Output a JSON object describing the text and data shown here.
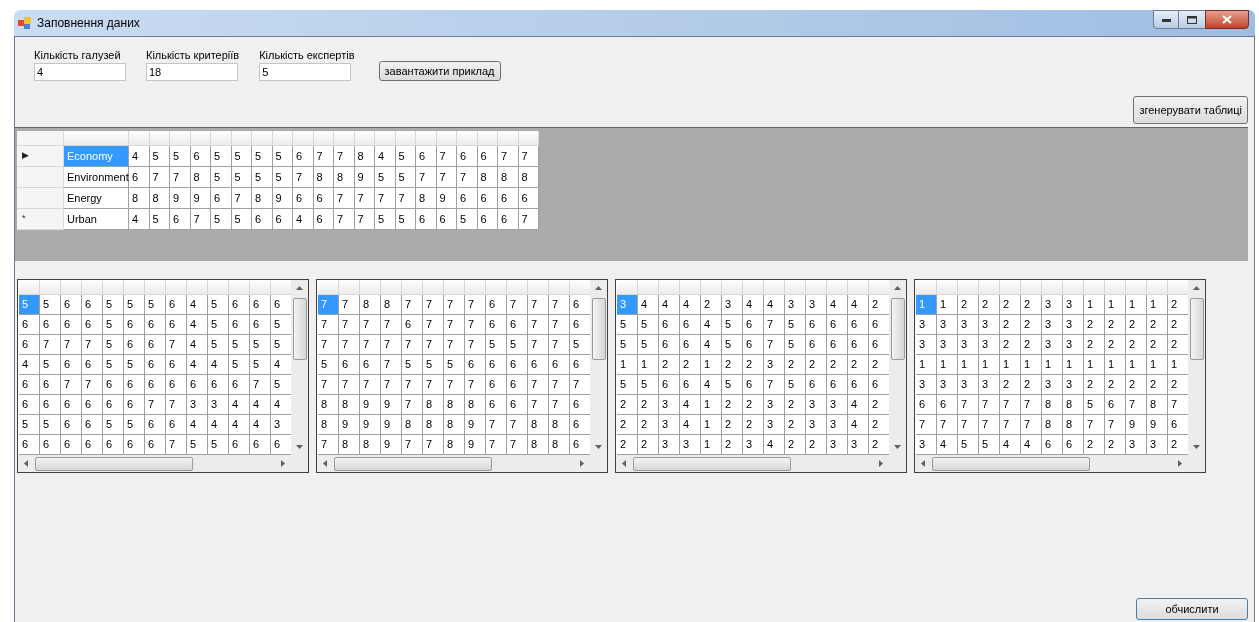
{
  "window": {
    "title": "Заповнення даних"
  },
  "fields": [
    {
      "label": "Кількість галузей",
      "value": "4"
    },
    {
      "label": "Кількість критеріїв",
      "value": "18"
    },
    {
      "label": "Кількість експертів",
      "value": "5"
    }
  ],
  "load_button": "завантажити приклад",
  "generate_button": "згенерувати таблиці",
  "top_grid": {
    "rows": [
      {
        "marker": "▶",
        "name": "Economy",
        "selected": true,
        "values": [
          "4",
          "5",
          "5",
          "6",
          "5",
          "5",
          "5",
          "5",
          "6",
          "7",
          "7",
          "8",
          "4",
          "5",
          "6",
          "7",
          "6",
          "6",
          "7",
          "7"
        ]
      },
      {
        "marker": "",
        "name": "Environment",
        "selected": false,
        "values": [
          "6",
          "7",
          "7",
          "8",
          "5",
          "5",
          "5",
          "5",
          "7",
          "8",
          "8",
          "9",
          "5",
          "5",
          "7",
          "7",
          "7",
          "8",
          "8",
          "8"
        ]
      },
      {
        "marker": "",
        "name": "Energy",
        "selected": false,
        "values": [
          "8",
          "8",
          "9",
          "9",
          "6",
          "7",
          "8",
          "9",
          "6",
          "6",
          "7",
          "7",
          "7",
          "7",
          "8",
          "9",
          "6",
          "6",
          "6",
          "6"
        ]
      },
      {
        "marker": "*",
        "name": "Urban",
        "selected": false,
        "values": [
          "4",
          "5",
          "6",
          "7",
          "5",
          "5",
          "6",
          "6",
          "4",
          "6",
          "7",
          "7",
          "5",
          "5",
          "6",
          "6",
          "5",
          "6",
          "6",
          "7"
        ]
      }
    ]
  },
  "expert_grids": [
    {
      "rows": [
        {
          "selected": true,
          "cells": [
            "5",
            "5",
            "6",
            "6",
            "5",
            "5",
            "5",
            "6",
            "4",
            "5",
            "6",
            "6",
            "6"
          ]
        },
        {
          "selected": false,
          "cells": [
            "6",
            "6",
            "6",
            "6",
            "5",
            "6",
            "6",
            "6",
            "4",
            "5",
            "6",
            "6",
            "5"
          ]
        },
        {
          "selected": false,
          "cells": [
            "6",
            "7",
            "7",
            "7",
            "5",
            "6",
            "6",
            "7",
            "4",
            "5",
            "5",
            "5",
            "5"
          ]
        },
        {
          "selected": false,
          "cells": [
            "4",
            "5",
            "6",
            "6",
            "5",
            "5",
            "6",
            "6",
            "4",
            "4",
            "5",
            "5",
            "4"
          ]
        },
        {
          "selected": false,
          "cells": [
            "6",
            "6",
            "7",
            "7",
            "6",
            "6",
            "6",
            "6",
            "6",
            "6",
            "6",
            "7",
            "5"
          ]
        },
        {
          "selected": false,
          "cells": [
            "6",
            "6",
            "6",
            "6",
            "6",
            "6",
            "7",
            "7",
            "3",
            "3",
            "4",
            "4",
            "4"
          ]
        },
        {
          "selected": false,
          "cells": [
            "5",
            "5",
            "6",
            "6",
            "5",
            "5",
            "6",
            "6",
            "4",
            "4",
            "4",
            "4",
            "3"
          ]
        },
        {
          "selected": false,
          "cells": [
            "6",
            "6",
            "6",
            "6",
            "6",
            "6",
            "6",
            "7",
            "5",
            "5",
            "6",
            "6",
            "6"
          ]
        }
      ]
    },
    {
      "rows": [
        {
          "selected": true,
          "cells": [
            "7",
            "7",
            "8",
            "8",
            "7",
            "7",
            "7",
            "7",
            "6",
            "7",
            "7",
            "7",
            "6"
          ]
        },
        {
          "selected": false,
          "cells": [
            "7",
            "7",
            "7",
            "7",
            "6",
            "7",
            "7",
            "7",
            "6",
            "6",
            "7",
            "7",
            "6"
          ]
        },
        {
          "selected": false,
          "cells": [
            "7",
            "7",
            "7",
            "7",
            "7",
            "7",
            "7",
            "7",
            "5",
            "5",
            "7",
            "7",
            "5"
          ]
        },
        {
          "selected": false,
          "cells": [
            "5",
            "6",
            "6",
            "7",
            "5",
            "5",
            "5",
            "6",
            "6",
            "6",
            "6",
            "6",
            "6"
          ]
        },
        {
          "selected": false,
          "cells": [
            "7",
            "7",
            "7",
            "7",
            "7",
            "7",
            "7",
            "7",
            "6",
            "6",
            "7",
            "7",
            "7"
          ]
        },
        {
          "selected": false,
          "cells": [
            "8",
            "8",
            "9",
            "9",
            "7",
            "8",
            "8",
            "8",
            "6",
            "6",
            "7",
            "7",
            "6"
          ]
        },
        {
          "selected": false,
          "cells": [
            "8",
            "9",
            "9",
            "9",
            "8",
            "8",
            "8",
            "9",
            "7",
            "7",
            "8",
            "8",
            "6"
          ]
        },
        {
          "selected": false,
          "cells": [
            "7",
            "8",
            "8",
            "9",
            "7",
            "7",
            "8",
            "9",
            "7",
            "7",
            "8",
            "8",
            "6"
          ]
        }
      ]
    },
    {
      "rows": [
        {
          "selected": true,
          "cells": [
            "3",
            "4",
            "4",
            "4",
            "2",
            "3",
            "4",
            "4",
            "3",
            "3",
            "4",
            "4",
            "2"
          ]
        },
        {
          "selected": false,
          "cells": [
            "5",
            "5",
            "6",
            "6",
            "4",
            "5",
            "6",
            "7",
            "5",
            "6",
            "6",
            "6",
            "6"
          ]
        },
        {
          "selected": false,
          "cells": [
            "5",
            "5",
            "6",
            "6",
            "4",
            "5",
            "6",
            "7",
            "5",
            "6",
            "6",
            "6",
            "6"
          ]
        },
        {
          "selected": false,
          "cells": [
            "1",
            "1",
            "2",
            "2",
            "1",
            "2",
            "2",
            "3",
            "2",
            "2",
            "2",
            "2",
            "2"
          ]
        },
        {
          "selected": false,
          "cells": [
            "5",
            "5",
            "6",
            "6",
            "4",
            "5",
            "6",
            "7",
            "5",
            "6",
            "6",
            "6",
            "6"
          ]
        },
        {
          "selected": false,
          "cells": [
            "2",
            "2",
            "3",
            "4",
            "1",
            "2",
            "2",
            "3",
            "2",
            "3",
            "3",
            "4",
            "2"
          ]
        },
        {
          "selected": false,
          "cells": [
            "2",
            "2",
            "3",
            "4",
            "1",
            "2",
            "2",
            "3",
            "2",
            "3",
            "3",
            "4",
            "2"
          ]
        },
        {
          "selected": false,
          "cells": [
            "2",
            "2",
            "3",
            "3",
            "1",
            "2",
            "3",
            "4",
            "2",
            "2",
            "3",
            "3",
            "2"
          ]
        }
      ]
    },
    {
      "rows": [
        {
          "selected": true,
          "cells": [
            "1",
            "1",
            "2",
            "2",
            "2",
            "2",
            "3",
            "3",
            "1",
            "1",
            "1",
            "1",
            "2"
          ]
        },
        {
          "selected": false,
          "cells": [
            "3",
            "3",
            "3",
            "3",
            "2",
            "2",
            "3",
            "3",
            "2",
            "2",
            "2",
            "2",
            "2"
          ]
        },
        {
          "selected": false,
          "cells": [
            "3",
            "3",
            "3",
            "3",
            "2",
            "2",
            "3",
            "3",
            "2",
            "2",
            "2",
            "2",
            "2"
          ]
        },
        {
          "selected": false,
          "cells": [
            "1",
            "1",
            "1",
            "1",
            "1",
            "1",
            "1",
            "1",
            "1",
            "1",
            "1",
            "1",
            "1"
          ]
        },
        {
          "selected": false,
          "cells": [
            "3",
            "3",
            "3",
            "3",
            "2",
            "2",
            "3",
            "3",
            "2",
            "2",
            "2",
            "2",
            "2"
          ]
        },
        {
          "selected": false,
          "cells": [
            "6",
            "6",
            "7",
            "7",
            "7",
            "7",
            "8",
            "8",
            "5",
            "6",
            "7",
            "8",
            "7"
          ]
        },
        {
          "selected": false,
          "cells": [
            "7",
            "7",
            "7",
            "7",
            "7",
            "7",
            "8",
            "8",
            "7",
            "7",
            "9",
            "9",
            "6"
          ]
        },
        {
          "selected": false,
          "cells": [
            "3",
            "4",
            "5",
            "5",
            "4",
            "4",
            "6",
            "6",
            "2",
            "2",
            "3",
            "3",
            "2"
          ]
        }
      ]
    }
  ],
  "compute_button": "обчислити"
}
